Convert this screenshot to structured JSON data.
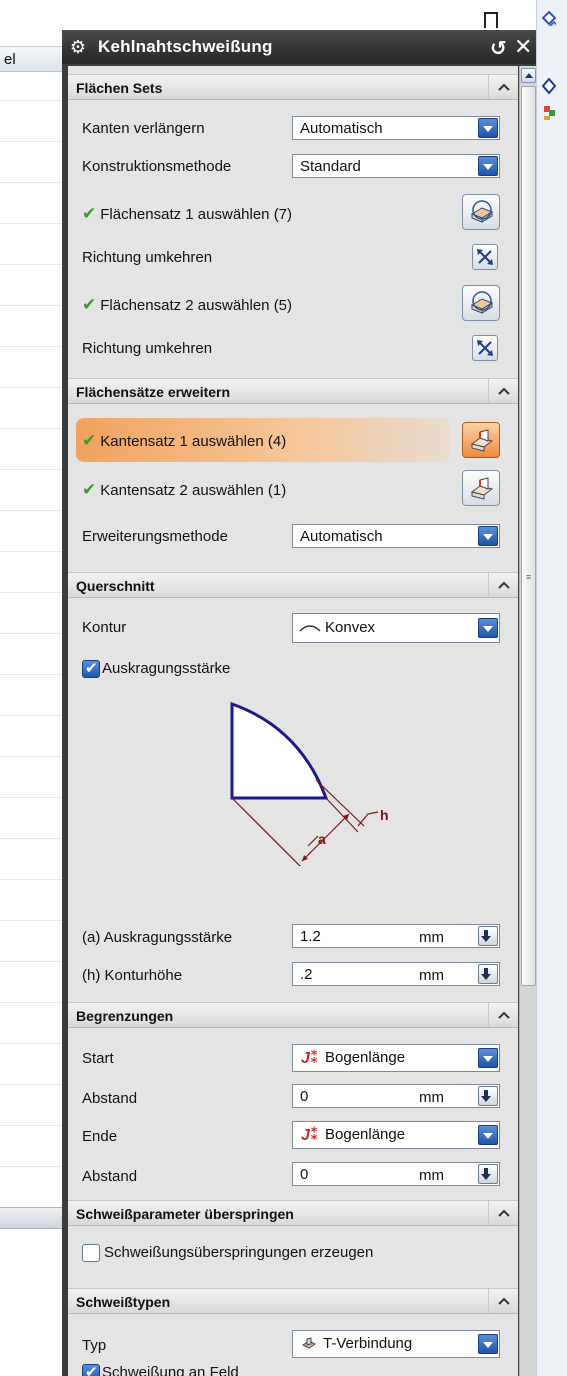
{
  "background": {
    "column_header": "el"
  },
  "dialog": {
    "title": "Kehlnahtschweißung",
    "sections": {
      "flaechen_sets": {
        "title": "Flächen Sets",
        "kanten_verlaengern_label": "Kanten verlängern",
        "kanten_verlaengern_value": "Automatisch",
        "konstruktionsmethode_label": "Konstruktionsmethode",
        "konstruktionsmethode_value": "Standard",
        "flaechensatz1": "Flächensatz 1 auswählen (7)",
        "richtung1": "Richtung umkehren",
        "flaechensatz2": "Flächensatz 2 auswählen (5)",
        "richtung2": "Richtung umkehren"
      },
      "erweitern": {
        "title": "Flächensätze erweitern",
        "kantensatz1": "Kantensatz 1 auswählen (4)",
        "kantensatz2": "Kantensatz 2 auswählen (1)",
        "methode_label": "Erweiterungsmethode",
        "methode_value": "Automatisch"
      },
      "querschnitt": {
        "title": "Querschnitt",
        "kontur_label": "Kontur",
        "kontur_value": "Konvex",
        "auskragung_checkbox": "Auskragungsstärke",
        "auskragung_checked": true,
        "diagram_label_h": "h",
        "diagram_label_a": "a",
        "a_label": "(a) Auskragungsstärke",
        "a_value": "1.2",
        "a_unit": "mm",
        "h_label": "(h) Konturhöhe",
        "h_value": ".2",
        "h_unit": "mm"
      },
      "begrenzungen": {
        "title": "Begrenzungen",
        "start_label": "Start",
        "start_value": "Bogenlänge",
        "abstand1_label": "Abstand",
        "abstand1_value": "0",
        "abstand1_unit": "mm",
        "ende_label": "Ende",
        "ende_value": "Bogenlänge",
        "abstand2_label": "Abstand",
        "abstand2_value": "0",
        "abstand2_unit": "mm"
      },
      "ueberspringen": {
        "title": "Schweißparameter überspringen",
        "checkbox_label": "Schweißungsüberspringungen erzeugen",
        "checked": false
      },
      "typen": {
        "title": "Schweißtypen",
        "typ_label": "Typ",
        "typ_value": "T-Verbindung",
        "feld_label": "Schweißung an Feld",
        "feld_checked": true
      }
    }
  },
  "colors": {
    "titlebar": "#2f2f2f",
    "check_green": "#3b9a2c",
    "highlight_orange": "#f1a25d",
    "dropdown_blue": "#1f56a8",
    "diagram_navy": "#1a1a8c",
    "diagram_maroon": "#7a1616"
  }
}
